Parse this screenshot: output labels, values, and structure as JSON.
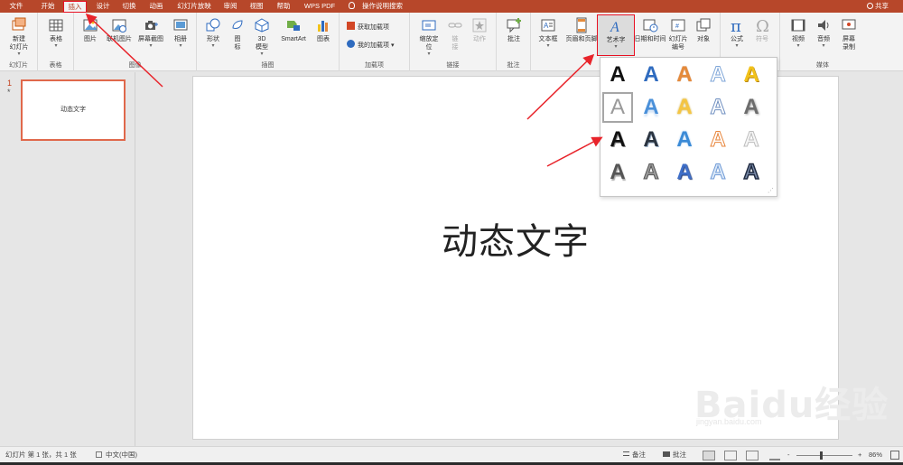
{
  "tabs": [
    "文件",
    "开始",
    "插入",
    "设计",
    "切换",
    "动画",
    "幻灯片放映",
    "审阅",
    "视图",
    "帮助",
    "WPS PDF"
  ],
  "active_tab": "插入",
  "search": "操作说明搜索",
  "share": "共享",
  "ribbon": {
    "slides": {
      "btn": "新建\n幻灯片",
      "label": "幻灯片"
    },
    "tables": {
      "btn": "表格",
      "label": "表格"
    },
    "images": {
      "picture": "图片",
      "online_picture": "联机图片",
      "screenshot": "屏幕截图",
      "album": "相册",
      "label": "图像"
    },
    "illustrations": {
      "shapes": "形状",
      "icons": "图\n标",
      "model3d": "3D\n模型",
      "smartart": "SmartArt",
      "chart": "图表",
      "label": "插图"
    },
    "addins": {
      "get": "获取加载项",
      "mine": "我的加载项",
      "label": "加载项"
    },
    "links": {
      "zoom": "缩放定\n位",
      "link": "链\n接",
      "action": "动作",
      "label": "链接"
    },
    "comments": {
      "comment": "批注",
      "label": "批注"
    },
    "text": {
      "textbox": "文本框",
      "header_footer": "页眉和页脚",
      "wordart": "艺术字",
      "datetime": "日期和时间",
      "slide_number": "幻灯片\n编号",
      "object": "对象"
    },
    "symbols": {
      "equation": "公式",
      "symbol": "符号"
    },
    "media": {
      "video": "视频",
      "audio": "音频",
      "screen_record": "屏幕\n录制",
      "label": "媒体"
    }
  },
  "slide_panel": {
    "number": "1",
    "star": "*",
    "thumb_text": "动态文字"
  },
  "slide": {
    "title": "动态文字"
  },
  "gallery": {
    "glyph": "A",
    "styles": [
      [
        "#111111",
        "#2f6bbf",
        "#e58a3a",
        "#c6d8ef",
        "#f2c21b"
      ],
      [
        "#9a9a9a",
        "#4a90d9",
        "#f5c542",
        "#9fb9e0",
        "#6d6d6d"
      ],
      [
        "#111111",
        "#2b3440",
        "#3a8ad6",
        "#f0a060",
        "#d9d9d9"
      ],
      [
        "#555555",
        "#7a7a7a",
        "#3f6fc8",
        "#a7c7ec",
        "#2d3b55"
      ]
    ]
  },
  "status": {
    "slide_info": "幻灯片 第 1 张，共 1 张",
    "language": "中文(中国)",
    "notes": "备注",
    "comments": "批注",
    "zoom": "86%",
    "zoom_minus": "-",
    "zoom_plus": "+"
  },
  "watermark": {
    "text": "Baidu经验",
    "url": "jingyan.baidu.com"
  },
  "colors": {
    "accent": "#b7472a",
    "highlight": "#e81123"
  }
}
